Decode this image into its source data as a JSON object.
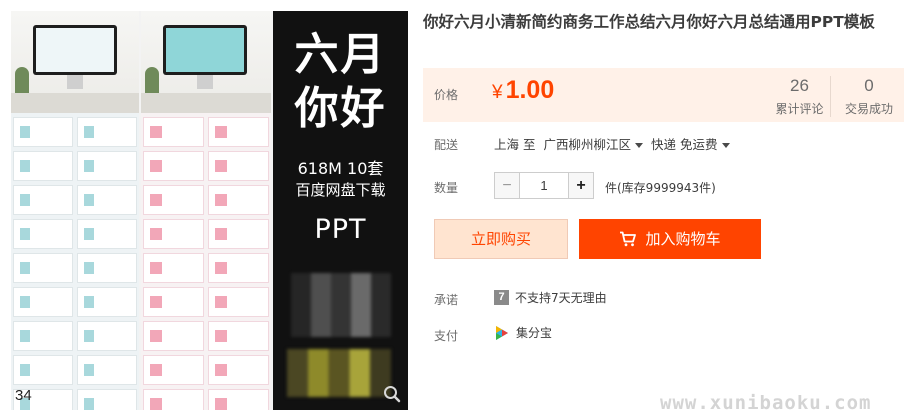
{
  "gallery": {
    "page_count": "34",
    "promo": {
      "line1": "六月",
      "line2": "你好",
      "meta": "618M  10套",
      "disk": "百度网盘下载",
      "ppt": "PPT"
    },
    "zoom_icon": "magnifier-icon"
  },
  "product": {
    "title": "你好六月小清新简约商务工作总结六月你好六月总结通用PPT模板"
  },
  "price_box": {
    "label": "价格",
    "currency": "¥",
    "price": "1.00",
    "reviews_count": "26",
    "reviews_label": "累计评论",
    "deals_count": "0",
    "deals_label": "交易成功"
  },
  "shipping": {
    "label": "配送",
    "from": "上海",
    "to_word": "至",
    "destination": "广西柳州柳江区",
    "method": "快递 免运费"
  },
  "quantity": {
    "label": "数量",
    "minus": "−",
    "value": "1",
    "plus": "+",
    "stock": "件(库存9999943件)"
  },
  "actions": {
    "buy_now": "立即购买",
    "add_cart": "加入购物车"
  },
  "promise": {
    "label": "承诺",
    "badge": "7",
    "text": "不支持7天无理由"
  },
  "payment": {
    "label": "支付",
    "method": "集分宝"
  },
  "footer": {
    "site": "www.xunibaoku.com"
  },
  "colors": {
    "accent": "#ff4400",
    "price_bg": "#fff1e8",
    "buy_now_bg": "#ffe4d0"
  }
}
